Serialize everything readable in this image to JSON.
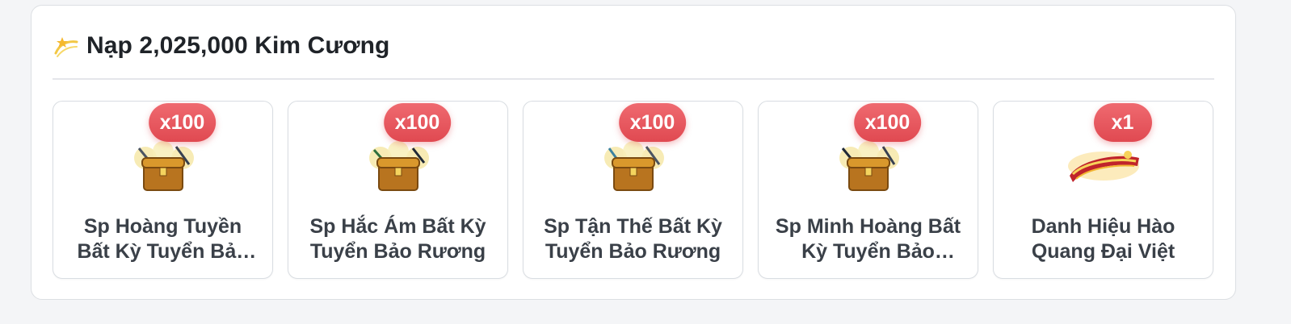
{
  "header": {
    "title": "Nạp 2,025,000 Kim Cương"
  },
  "rewards": [
    {
      "qty": "x100",
      "name": "Sp Hoàng Tuyền Bất Kỳ Tuyển Bảo Rương",
      "icon": "treasure-chest-icon"
    },
    {
      "qty": "x100",
      "name": "Sp Hắc Ám Bất Kỳ Tuyển Bảo Rương",
      "icon": "treasure-chest-icon"
    },
    {
      "qty": "x100",
      "name": "Sp Tận Thế Bất Kỳ Tuyển Bảo Rương",
      "icon": "treasure-chest-icon"
    },
    {
      "qty": "x100",
      "name": "Sp Minh Hoàng Bất Kỳ Tuyển Bảo Rương",
      "icon": "treasure-chest-icon"
    },
    {
      "qty": "x1",
      "name": "Danh Hiệu Hào Quang Đại Việt",
      "icon": "title-banner-icon"
    }
  ],
  "colors": {
    "badge": "#e5525a",
    "text": "#3a4048",
    "title": "#1f2328"
  }
}
